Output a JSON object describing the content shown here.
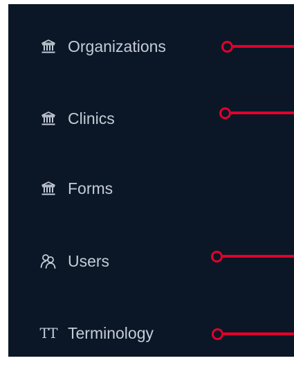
{
  "colors": {
    "sidebar_bg": "#0b1727",
    "text": "#c4ccd7",
    "annotation": "#e4002b"
  },
  "nav": {
    "items": [
      {
        "label": "Organizations",
        "icon": "building-columns-icon"
      },
      {
        "label": "Clinics",
        "icon": "building-columns-icon"
      },
      {
        "label": "Forms",
        "icon": "building-columns-icon"
      },
      {
        "label": "Users",
        "icon": "users-icon"
      },
      {
        "label": "Terminology",
        "icon": "text-size-icon",
        "icon_text": "TT"
      }
    ]
  }
}
